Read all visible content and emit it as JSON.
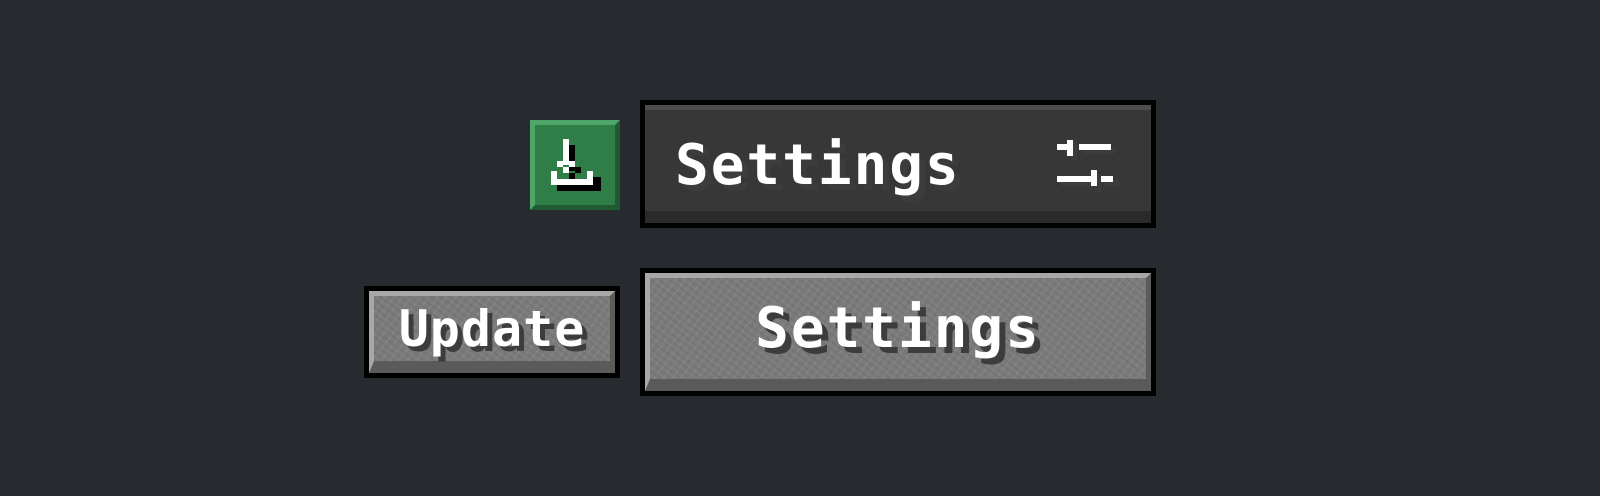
{
  "buttons": {
    "download": {
      "icon": "download-icon",
      "color": "#2f7d47"
    },
    "settings_dark": {
      "label": "Settings",
      "icon": "sliders-icon"
    },
    "update": {
      "label": "Update"
    },
    "settings_stone": {
      "label": "Settings"
    }
  },
  "colors": {
    "background": "#272b30",
    "dark_button_face": "#373737",
    "stone_button_face": "#7b7b7b",
    "text": "#ffffff",
    "text_shadow": "#3c3c3c"
  }
}
